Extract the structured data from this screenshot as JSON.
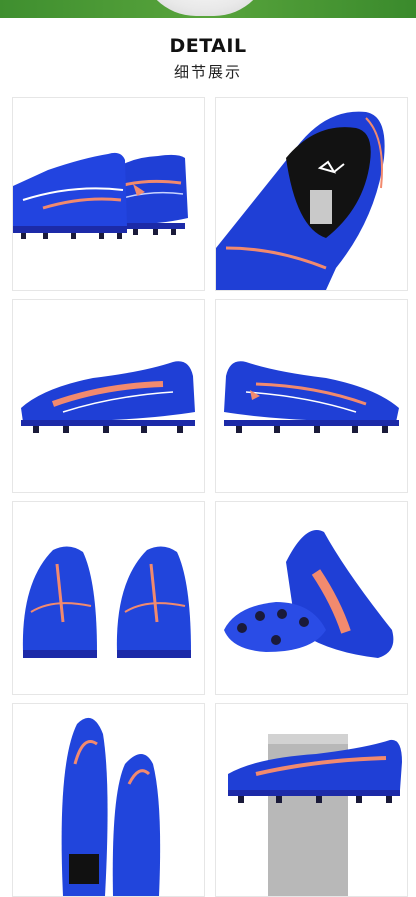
{
  "header": {
    "title": "DETAIL",
    "subtitle": "细节展示"
  },
  "colors": {
    "accent_blue": "#1e3fd8",
    "accent_orange": "#f27a5c",
    "banner_green": "#4e9a36"
  }
}
